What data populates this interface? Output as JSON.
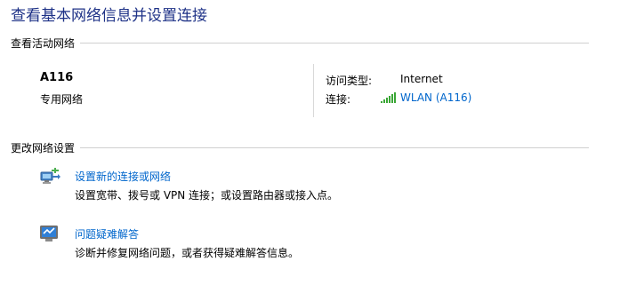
{
  "page": {
    "title": "查看基本网络信息并设置连接"
  },
  "active_networks": {
    "section_label": "查看活动网络",
    "network": {
      "name": "A116",
      "type": "专用网络",
      "access_type_label": "访问类型:",
      "access_type_value": "Internet",
      "connection_label": "连接:",
      "connection_value": "WLAN (A116)",
      "connection_icon": "wifi-signal-icon"
    }
  },
  "change_settings": {
    "section_label": "更改网络设置",
    "tasks": [
      {
        "link": "设置新的连接或网络",
        "description": "设置宽带、拨号或 VPN 连接；或设置路由器或接入点。",
        "icon": "new-connection-icon"
      },
      {
        "link": "问题疑难解答",
        "description": "诊断并修复网络问题，或者获得疑难解答信息。",
        "icon": "troubleshoot-icon"
      }
    ]
  },
  "colors": {
    "title": "#1e3287",
    "link": "#0066cc",
    "signal": "#3aa635"
  }
}
